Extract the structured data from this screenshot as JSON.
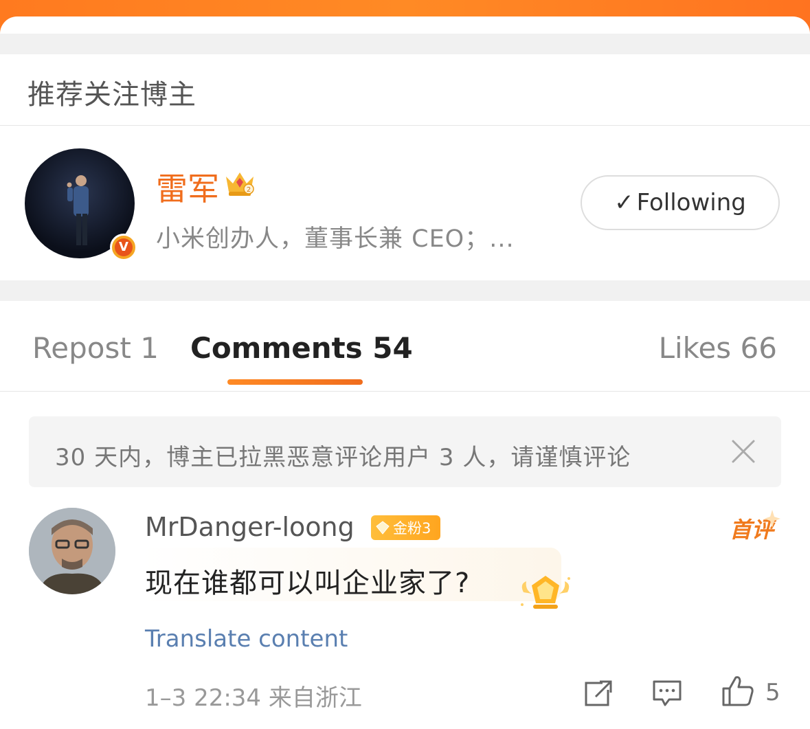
{
  "recommend": {
    "title": "推荐关注博主",
    "blogger": {
      "name": "雷军",
      "description": "小米创办人，董事长兼 CEO；...",
      "follow_label": "Following",
      "follow_check": "✓"
    }
  },
  "tabs": [
    {
      "label": "Repost 1",
      "active": false
    },
    {
      "label": "Comments 54",
      "active": true
    },
    {
      "label": "Likes 66",
      "active": false
    }
  ],
  "notice": {
    "text": "30 天内，博主已拉黑恶意评论用户 3 人，请谨慎评论"
  },
  "comment": {
    "username": "MrDanger-loong",
    "badge": "金粉3",
    "first_tag": "首评",
    "text": "现在谁都可以叫企业家了?",
    "translate_label": "Translate content",
    "time": "1–3 22:34 来自浙江",
    "like_count": "5"
  },
  "colors": {
    "accent": "#f06d1d",
    "top_bar": "#ff7a1f",
    "link": "#5a7fb0"
  }
}
